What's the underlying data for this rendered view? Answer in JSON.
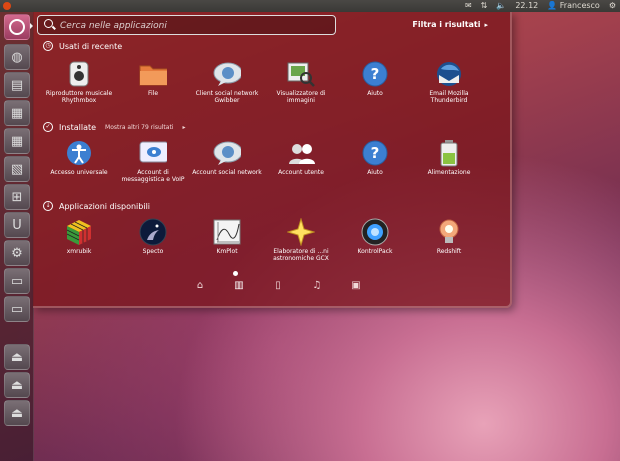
{
  "panel": {
    "clock": "22.12",
    "user": "Francesco"
  },
  "search": {
    "placeholder": "Cerca nelle applicazioni",
    "value": ""
  },
  "filter_label": "Filtra i risultati",
  "sections": {
    "recent": {
      "title": "Usati di recente",
      "apps": [
        {
          "label": "Riproduttore musicale Rhythmbox",
          "icon": "speaker-icon"
        },
        {
          "label": "File",
          "icon": "folder-icon"
        },
        {
          "label": "Client social network Gwibber",
          "icon": "chat-bubble-icon"
        },
        {
          "label": "Visualizzatore di immagini",
          "icon": "image-viewer-icon"
        },
        {
          "label": "Aiuto",
          "icon": "help-icon"
        },
        {
          "label": "Email Mozilla Thunderbird",
          "icon": "thunderbird-icon"
        }
      ]
    },
    "installed": {
      "title": "Installate",
      "more": "Mostra altri 79 risultati",
      "apps": [
        {
          "label": "Accesso universale",
          "icon": "accessibility-icon"
        },
        {
          "label": "Account di messaggistica e VoIP",
          "icon": "messaging-icon"
        },
        {
          "label": "Account social network",
          "icon": "chat-bubble-icon"
        },
        {
          "label": "Account utente",
          "icon": "users-icon"
        },
        {
          "label": "Aiuto",
          "icon": "help-icon"
        },
        {
          "label": "Alimentazione",
          "icon": "battery-icon"
        }
      ]
    },
    "available": {
      "title": "Applicazioni disponibili",
      "apps": [
        {
          "label": "xmrubik",
          "icon": "rubik-cube-icon"
        },
        {
          "label": "Specto",
          "icon": "specto-icon"
        },
        {
          "label": "KmPlot",
          "icon": "plot-icon"
        },
        {
          "label": "Elaboratore di ...ni astronomiche GCX",
          "icon": "star-icon"
        },
        {
          "label": "KontrolPack",
          "icon": "kontrolpack-icon"
        },
        {
          "label": "Redshift",
          "icon": "bulb-icon"
        }
      ]
    }
  },
  "lenses": [
    "home-lens-icon",
    "applications-lens-icon",
    "files-lens-icon",
    "music-lens-icon",
    "video-lens-icon"
  ],
  "colors": {
    "accent": "#dd4814",
    "dash_bg": "#781419"
  }
}
